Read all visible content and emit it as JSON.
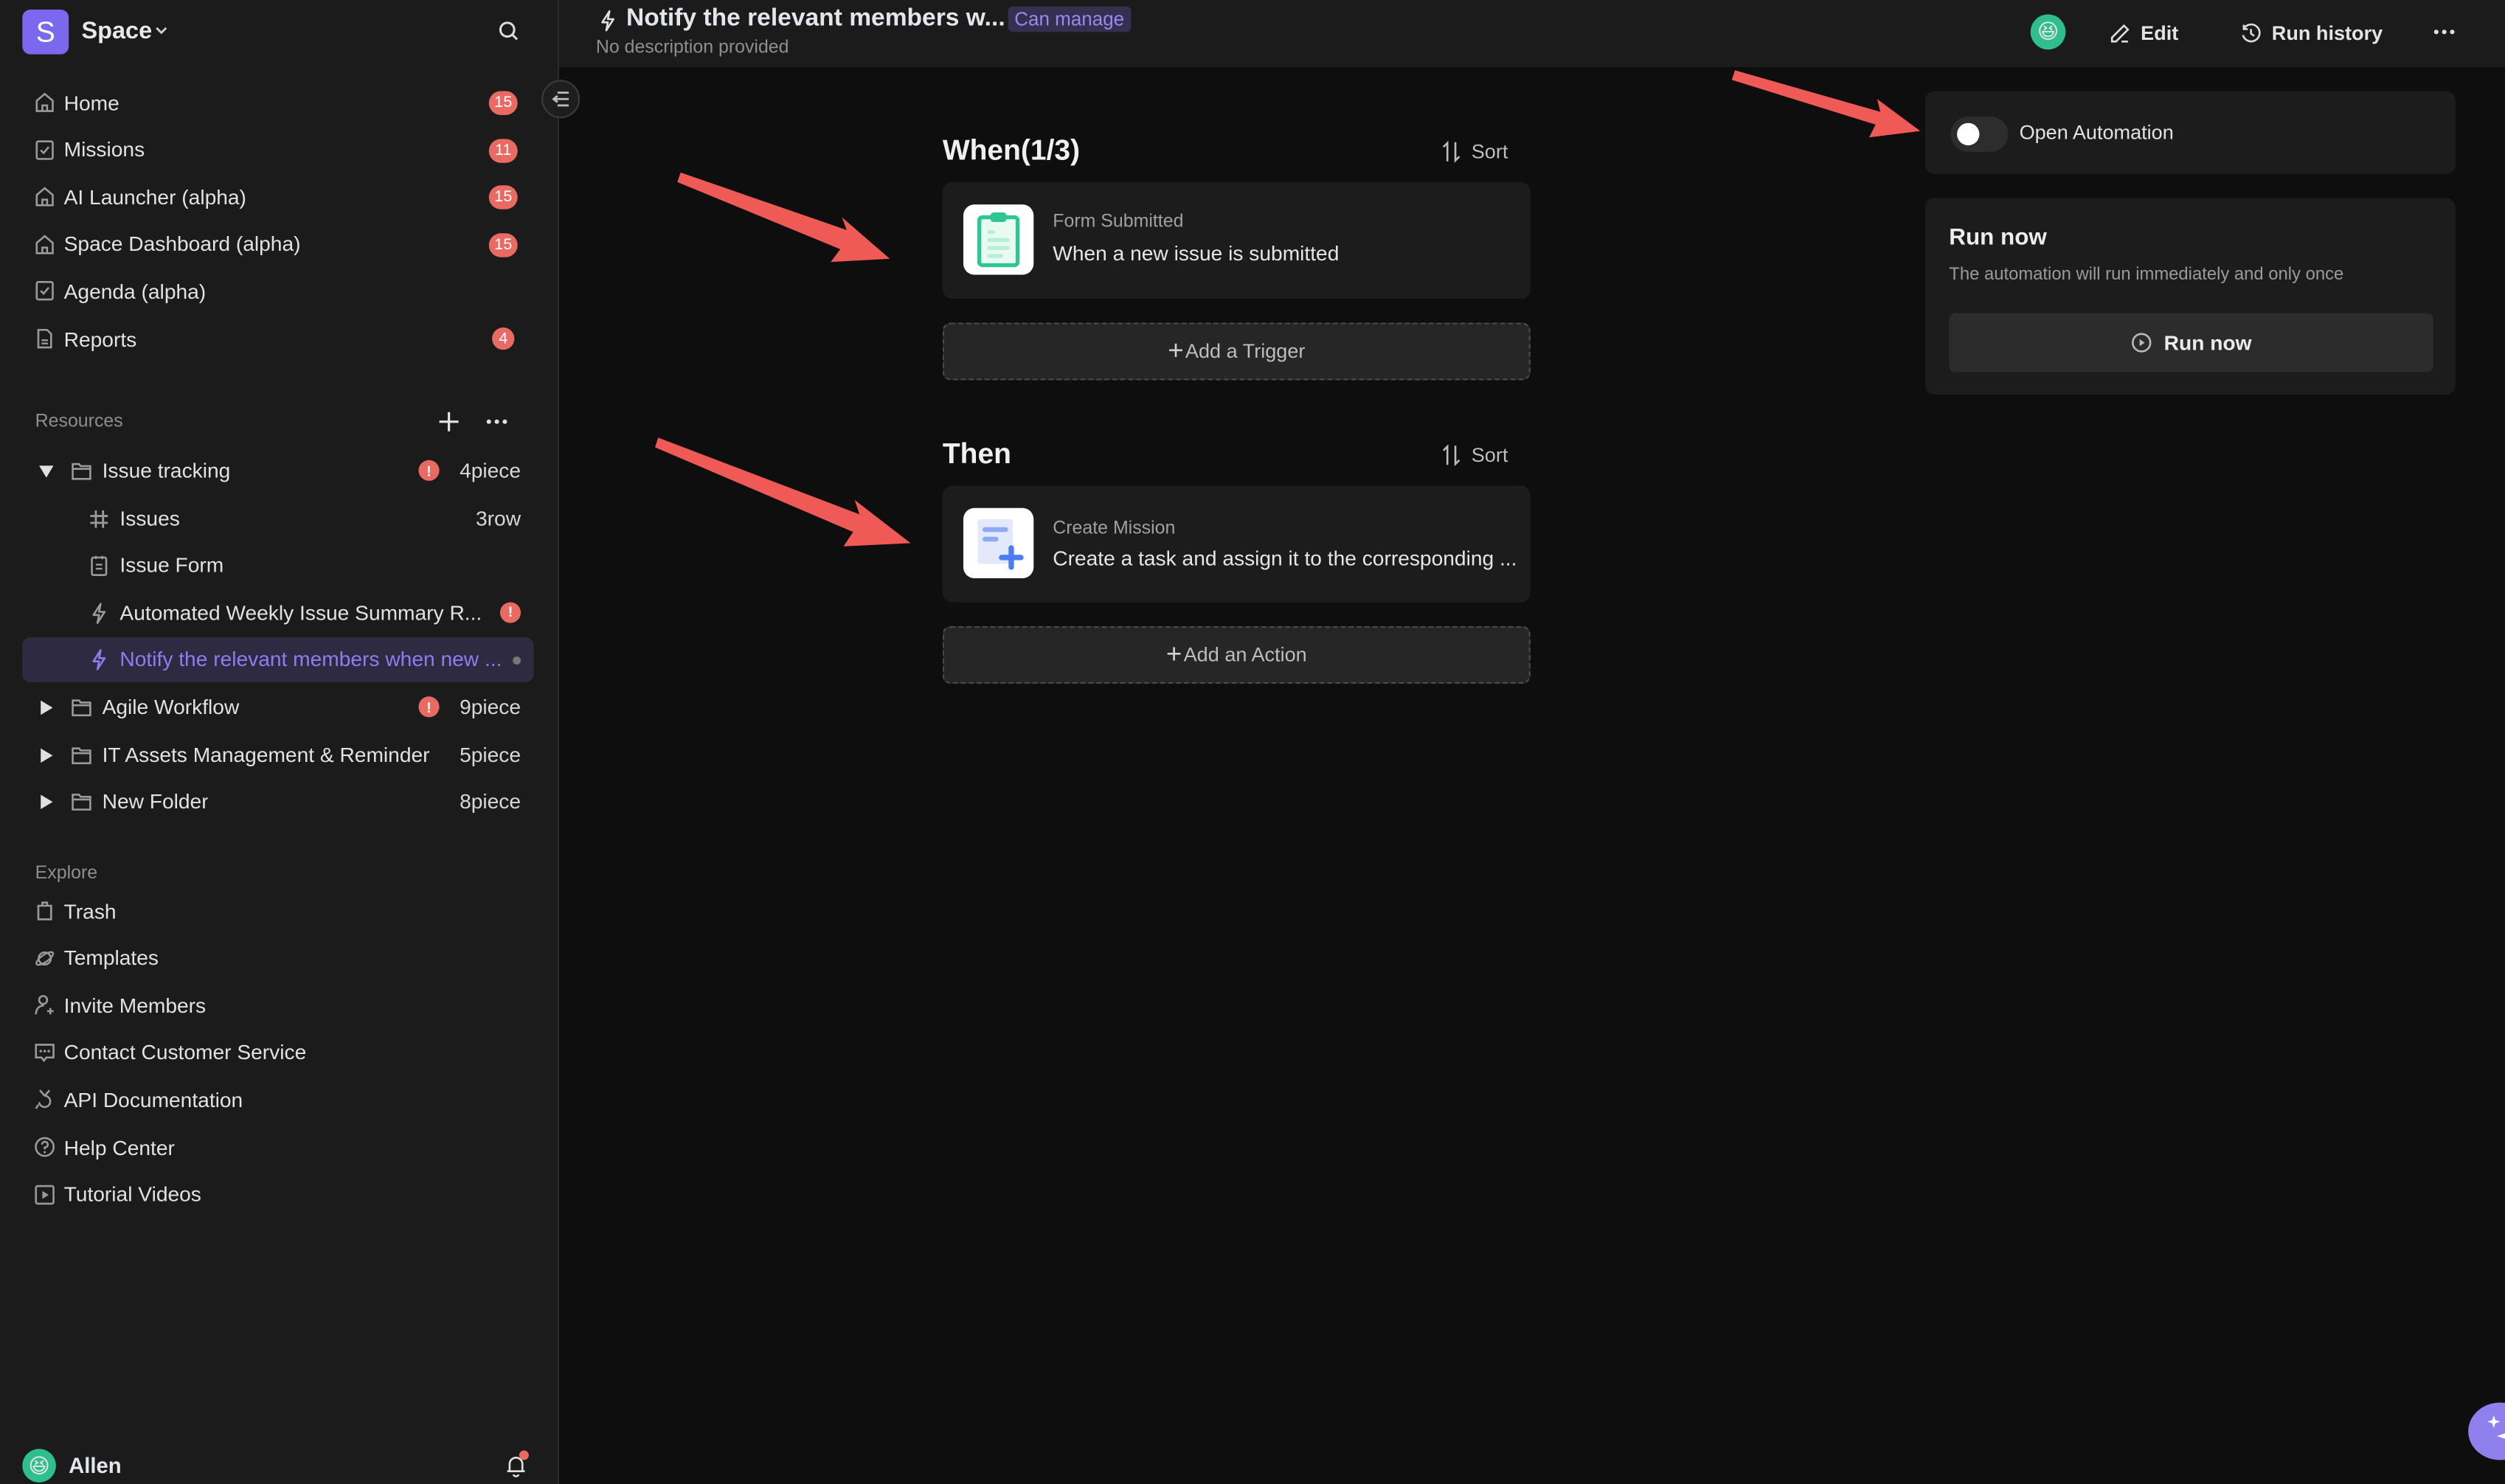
{
  "sidebar": {
    "space_initial": "S",
    "space_name": "Space",
    "nav": [
      {
        "label": "Home",
        "icon": "home-icon",
        "badge": "15"
      },
      {
        "label": "Missions",
        "icon": "checkbox-icon",
        "badge": "11"
      },
      {
        "label": "AI Launcher (alpha)",
        "icon": "home-icon",
        "badge": "15"
      },
      {
        "label": "Space Dashboard (alpha)",
        "icon": "home-icon",
        "badge": "15"
      },
      {
        "label": "Agenda (alpha)",
        "icon": "checkbox-icon",
        "badge": null
      },
      {
        "label": "Reports",
        "icon": "report-icon",
        "badge": "4"
      }
    ],
    "resources_label": "Resources",
    "tree": [
      {
        "label": "Issue tracking",
        "type": "folder",
        "expanded": true,
        "alert": true,
        "count": "4piece"
      },
      {
        "label": "Issues",
        "type": "table",
        "count": "3row"
      },
      {
        "label": "Issue Form",
        "type": "form",
        "count": ""
      },
      {
        "label": "Automated Weekly Issue Summary R...",
        "type": "automation",
        "alert": true
      },
      {
        "label": "Notify the relevant members when new ...",
        "type": "automation",
        "active": true
      },
      {
        "label": "Agile Workflow",
        "type": "folder",
        "expanded": false,
        "alert": true,
        "count": "9piece"
      },
      {
        "label": "IT Assets Management & Reminder",
        "type": "folder",
        "expanded": false,
        "count": "5piece"
      },
      {
        "label": "New Folder",
        "type": "folder",
        "expanded": false,
        "count": "8piece"
      }
    ],
    "explore_label": "Explore",
    "explore": [
      {
        "label": "Trash",
        "icon": "trash-icon"
      },
      {
        "label": "Templates",
        "icon": "planet-icon"
      },
      {
        "label": "Invite Members",
        "icon": "user-add-icon"
      },
      {
        "label": "Contact Customer Service",
        "icon": "chat-icon"
      },
      {
        "label": "API Documentation",
        "icon": "api-icon"
      },
      {
        "label": "Help Center",
        "icon": "help-icon"
      },
      {
        "label": "Tutorial Videos",
        "icon": "video-icon"
      }
    ],
    "user_name": "Allen",
    "user_emoji": "😆"
  },
  "header": {
    "title": "Notify the relevant members w...",
    "permission": "Can manage",
    "description": "No description provided",
    "avatar_emoji": "😆",
    "edit_label": "Edit",
    "run_history_label": "Run history"
  },
  "flow": {
    "when_title": "When(1/3)",
    "then_title": "Then",
    "sort_label": "Sort",
    "trigger": {
      "kind": "Form Submitted",
      "text": "When a new issue is submitted"
    },
    "add_trigger_label": "Add a Trigger",
    "action": {
      "kind": "Create Mission",
      "text": "Create a task and assign it to the corresponding ..."
    },
    "add_action_label": "Add an Action"
  },
  "panel": {
    "toggle_label": "Open Automation",
    "toggle_on": false,
    "run_title": "Run now",
    "run_desc": "The automation will run immediately and only once",
    "run_button": "Run now"
  },
  "colors": {
    "accent": "#7b68ee",
    "badge": "#e86a62",
    "annotation_arrow": "#ef5a56"
  }
}
